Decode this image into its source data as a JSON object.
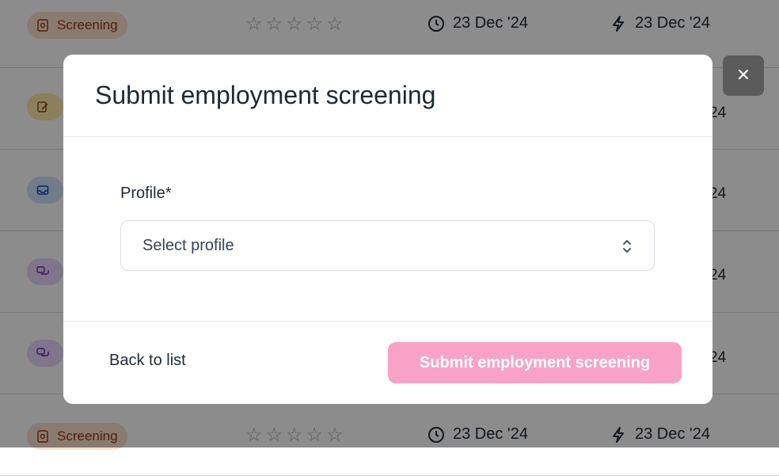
{
  "background_list": {
    "rows": [
      {
        "badge_label": "Screening",
        "stars_icon": "star-outline-icon",
        "date": "23 Dec '24",
        "activity_date": "23 Dec '24"
      },
      {
        "badge_label": "",
        "right_fragment": "24"
      },
      {
        "badge_label": "",
        "right_fragment": "24"
      },
      {
        "badge_label": "",
        "right_fragment": "24"
      },
      {
        "badge_label": "",
        "right_fragment": "24"
      },
      {
        "badge_label": "Screening",
        "stars_icon": "star-outline-icon",
        "date": "23 Dec '24",
        "activity_date": "23 Dec '24"
      }
    ]
  },
  "modal": {
    "title": "Submit employment screening",
    "profile_label": "Profile*",
    "profile_select": {
      "value": "Select profile",
      "icon": "chevron-up-down-icon"
    },
    "back_label": "Back to list",
    "submit_label": "Submit employment screening",
    "close_icon": "close-icon"
  },
  "colors": {
    "submit_button": "#f8a3c6",
    "overlay": "rgba(0,0,0,0.45)",
    "close_button": "#5b5b5b"
  }
}
